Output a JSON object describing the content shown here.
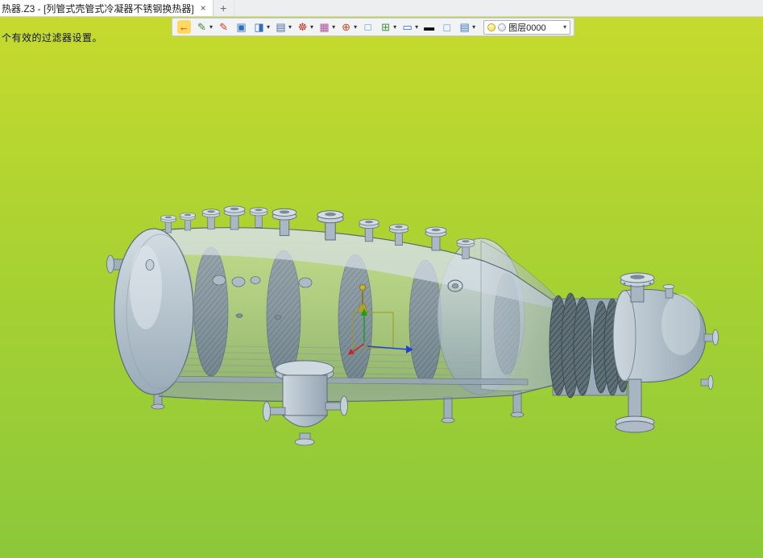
{
  "window": {
    "tab_title": "热器.Z3 - [列管式壳管式冷凝器不锈钢换热器]",
    "tab_close": "×",
    "new_tab": "+"
  },
  "toolbar": {
    "caret_glyph": "▾",
    "items": [
      {
        "name": "exit-icon",
        "glyph": "←",
        "color": "#c82818",
        "bg": "#ffd95e",
        "dropdown": false
      },
      {
        "name": "render-pencil-icon",
        "glyph": "✎",
        "color": "#3a8a2e",
        "bg": "",
        "dropdown": true
      },
      {
        "name": "sketch-pen-icon",
        "glyph": "✎",
        "color": "#c43b2a",
        "bg": "",
        "dropdown": false
      },
      {
        "name": "shaded-cube-icon",
        "glyph": "▣",
        "color": "#2f6fbd",
        "bg": "",
        "dropdown": false
      },
      {
        "name": "display-mode-cube-icon",
        "glyph": "◨",
        "color": "#2f6fbd",
        "bg": "",
        "dropdown": true
      },
      {
        "name": "solid-stack-icon",
        "glyph": "▤",
        "color": "#4a6f9d",
        "bg": "",
        "dropdown": true
      },
      {
        "name": "wheel-icon",
        "glyph": "☸",
        "color": "#cc3322",
        "bg": "",
        "dropdown": true
      },
      {
        "name": "image-icon",
        "glyph": "▦",
        "color": "#b0529a",
        "bg": "",
        "dropdown": true
      },
      {
        "name": "target-icon",
        "glyph": "⊕",
        "color": "#c04a2a",
        "bg": "",
        "dropdown": true
      },
      {
        "name": "selection-box-icon",
        "glyph": "□",
        "color": "#4a90d9",
        "bg": "",
        "dropdown": false
      },
      {
        "name": "window-plus-icon",
        "glyph": "⊞",
        "color": "#3f8f3f",
        "bg": "",
        "dropdown": true
      },
      {
        "name": "monitor-icon",
        "glyph": "▭",
        "color": "#2f6fbd",
        "bg": "",
        "dropdown": true
      },
      {
        "name": "line-width-icon",
        "glyph": "▬",
        "color": "#111111",
        "bg": "",
        "dropdown": false
      },
      {
        "name": "light-square-icon",
        "glyph": "◻",
        "color": "#7aa9d8",
        "bg": "",
        "dropdown": false
      },
      {
        "name": "layers-icon",
        "glyph": "▤",
        "color": "#3a7abf",
        "bg": "",
        "dropdown": true
      }
    ],
    "layer_combo": {
      "value": "图层0000",
      "caret": "▾"
    }
  },
  "status_message": "个有效的过滤器设置。",
  "colors": {
    "viewport_gradient_top": "#c6da2e",
    "viewport_gradient_bottom": "#8cc83a",
    "model_body": "#b9c6d2",
    "model_outline": "#5d6c77",
    "baffle_dark": "#5f7076",
    "axis_green": "#18a018",
    "axis_blue": "#2244cc",
    "axis_red": "#cc2222",
    "highlight_olive": "#9a9a20"
  }
}
